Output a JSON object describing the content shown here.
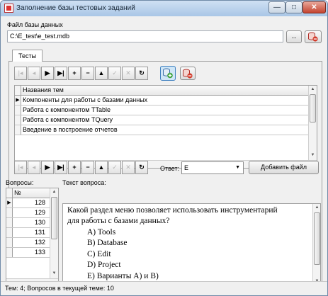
{
  "window": {
    "title": "Заполнение базы тестовых заданий",
    "minimize_glyph": "—",
    "maximize_glyph": "□",
    "close_glyph": "✕"
  },
  "db_file": {
    "label": "Файл базы данных",
    "value": "C:\\E_test\\e_test.mdb",
    "browse_label": "...",
    "remove_icon": "database-delete-icon"
  },
  "tabs": [
    {
      "label": "Тесты",
      "active": true
    }
  ],
  "topics_nav": {
    "buttons": [
      {
        "name": "nav-first-button",
        "glyph": "|◂",
        "enabled": false
      },
      {
        "name": "nav-prior-button",
        "glyph": "◂",
        "enabled": false
      },
      {
        "name": "nav-next-button",
        "glyph": "▶",
        "enabled": true
      },
      {
        "name": "nav-last-button",
        "glyph": "▶|",
        "enabled": true
      },
      {
        "name": "nav-insert-button",
        "glyph": "+",
        "enabled": true
      },
      {
        "name": "nav-delete-button",
        "glyph": "−",
        "enabled": true
      },
      {
        "name": "nav-edit-button",
        "glyph": "▲",
        "enabled": true
      },
      {
        "name": "nav-post-button",
        "glyph": "✓",
        "enabled": false
      },
      {
        "name": "nav-cancel-button",
        "glyph": "✕",
        "enabled": false
      },
      {
        "name": "nav-refresh-button",
        "glyph": "↻",
        "enabled": true
      }
    ],
    "add_icon": "database-add-icon",
    "remove_icon": "database-delete-icon"
  },
  "topics_grid": {
    "header": "Названия тем",
    "rows": [
      {
        "title": "Компоненты для работы с базами данных",
        "current": true
      },
      {
        "title": "Работа с компонентом TTable",
        "current": false
      },
      {
        "title": "Работа с компонентом TQuery",
        "current": false
      },
      {
        "title": "Введение в построение отчетов",
        "current": false
      }
    ]
  },
  "questions_nav": {
    "buttons": [
      {
        "name": "q-nav-first-button",
        "glyph": "|◂",
        "enabled": false
      },
      {
        "name": "q-nav-prior-button",
        "glyph": "◂",
        "enabled": false
      },
      {
        "name": "q-nav-next-button",
        "glyph": "▶",
        "enabled": true
      },
      {
        "name": "q-nav-last-button",
        "glyph": "▶|",
        "enabled": true
      },
      {
        "name": "q-nav-insert-button",
        "glyph": "+",
        "enabled": true
      },
      {
        "name": "q-nav-delete-button",
        "glyph": "−",
        "enabled": true
      },
      {
        "name": "q-nav-edit-button",
        "glyph": "▲",
        "enabled": true
      },
      {
        "name": "q-nav-post-button",
        "glyph": "✓",
        "enabled": false
      },
      {
        "name": "q-nav-cancel-button",
        "glyph": "✕",
        "enabled": false
      },
      {
        "name": "q-nav-refresh-button",
        "glyph": "↻",
        "enabled": true
      }
    ],
    "answer_label": "Ответ:",
    "answer_value": "E",
    "dropdown_glyph": "▼",
    "add_file_label": "Добавить файл"
  },
  "questions": {
    "label": "Вопросы:",
    "header": "№",
    "numbers": [
      "128",
      "129",
      "130",
      "131",
      "132",
      "133"
    ],
    "current_index": 0
  },
  "question_text": {
    "label": "Текст вопроса:",
    "lines": [
      "Какой раздел меню позволяет использовать инструментарий",
      "для работы с базами данных?",
      "A) Tools",
      "B) Database",
      "C) Edit",
      "D) Project",
      "E) Варианты A) и B)"
    ]
  },
  "status": {
    "text": "Тем: 4; Вопросов в текущей теме: 10"
  },
  "colors": {
    "title_bar": "#b9d1ea",
    "close_button": "#c4432f",
    "icon_red": "#d23a2a",
    "icon_green": "#3aa13a",
    "selected_tool": "#cfe6f7"
  }
}
